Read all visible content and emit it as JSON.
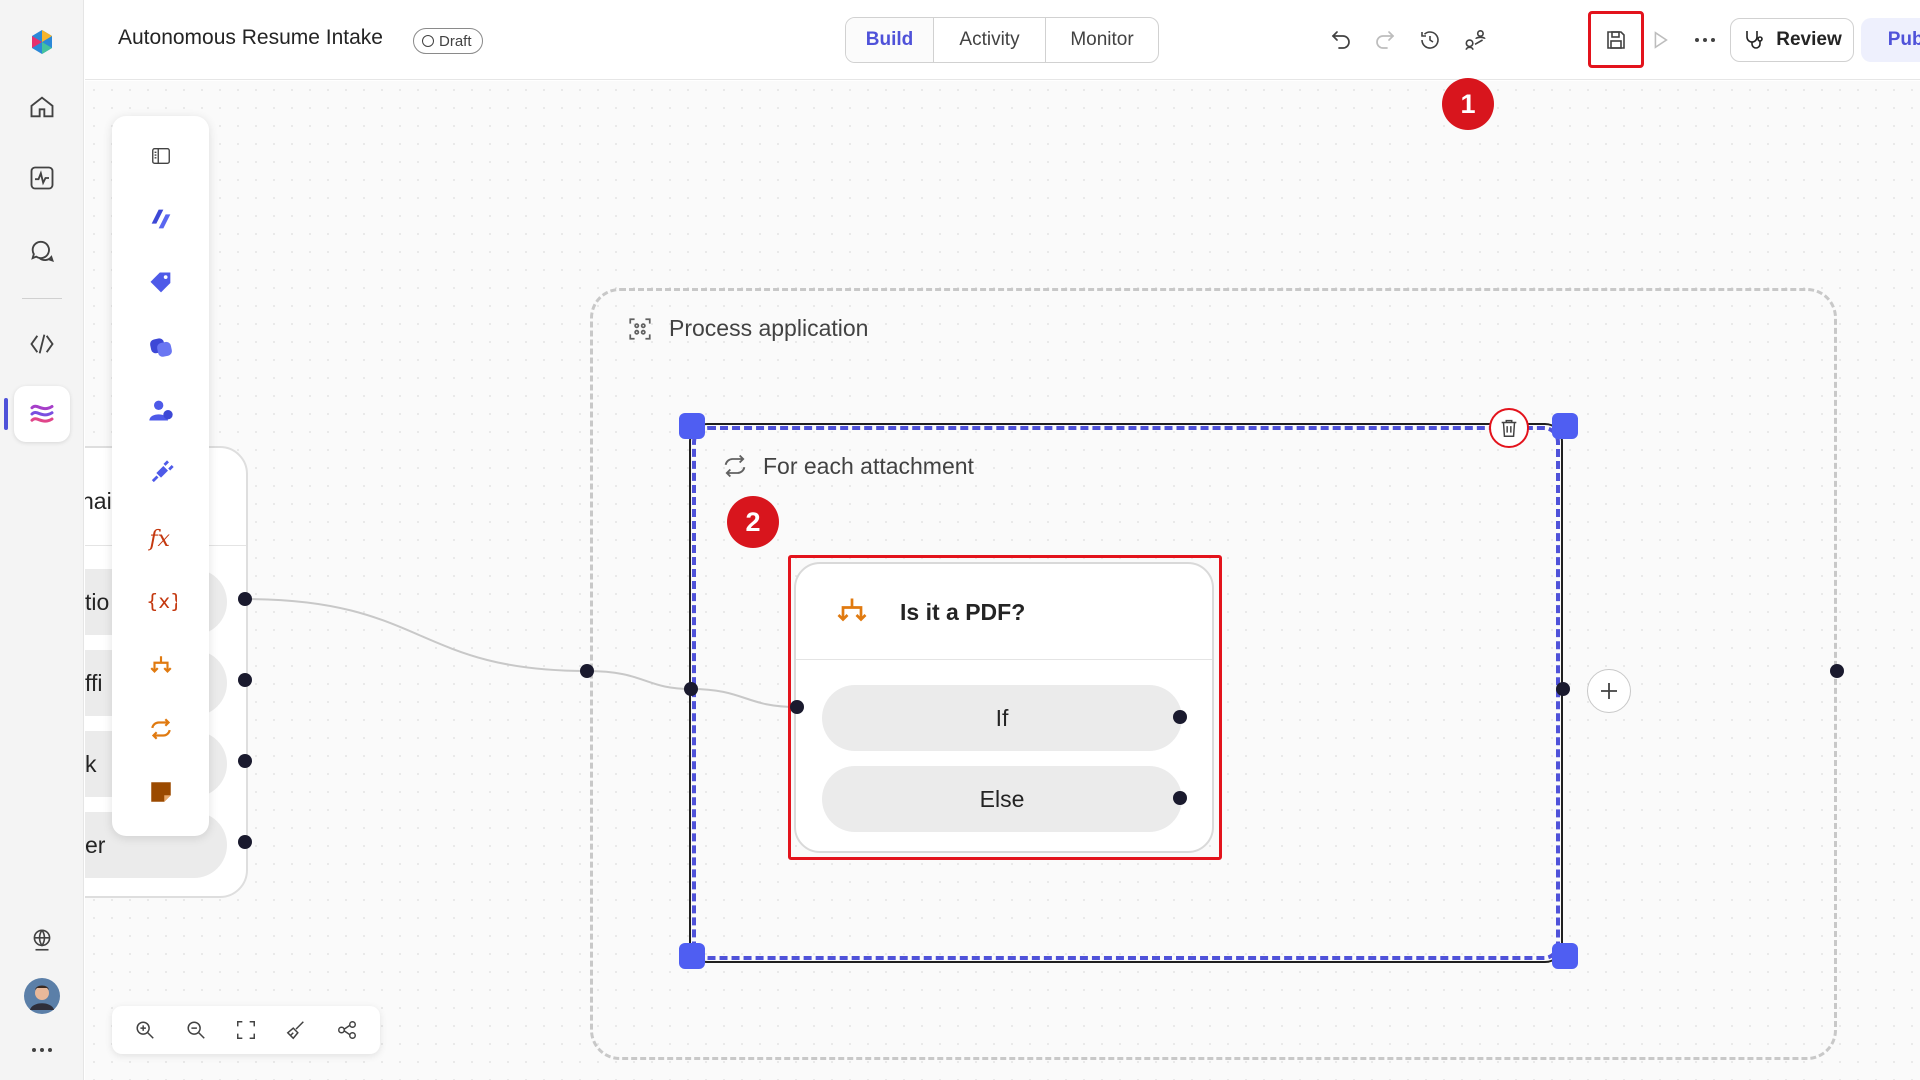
{
  "header": {
    "title": "Autonomous Resume Intake",
    "status_badge": "Draft",
    "tabs": [
      {
        "label": "Build",
        "selected": true
      },
      {
        "label": "Activity",
        "selected": false
      },
      {
        "label": "Monitor",
        "selected": false
      }
    ],
    "review_label": "Review",
    "publish_label": "Publish"
  },
  "annotations": {
    "step1": "1",
    "step2": "2"
  },
  "canvas": {
    "left_node": {
      "top_text": "nai",
      "rows": [
        "tio",
        "ffi",
        "k",
        "er"
      ]
    },
    "process_group": {
      "title": "Process application"
    },
    "loop": {
      "title": "For each attachment"
    },
    "condition": {
      "title": "Is it a PDF?",
      "branches": [
        "If",
        "Else"
      ]
    }
  },
  "colors": {
    "accent": "#4f52d9",
    "highlight_red": "#e3131c",
    "orange_icon": "#e07a10",
    "red_icon": "#c4380f",
    "handle_blue": "#4f5ef2"
  },
  "icons": {
    "rail": [
      "copilot-logo-icon",
      "home-icon",
      "activity-icon",
      "chat-icon",
      "code-brackets-icon",
      "agent-flows-icon",
      "globe-icon",
      "avatar",
      "more-icon"
    ],
    "toolbox": [
      "panel-toggle-icon",
      "ai-builder-icon",
      "tag-icon",
      "copilot-connector-icon",
      "human-review-icon",
      "connector-plug-icon",
      "function-fx-icon",
      "variable-icon",
      "condition-icon",
      "loop-icon",
      "sticky-note-icon"
    ],
    "zoombar": [
      "zoom-in-icon",
      "zoom-out-icon",
      "fit-view-icon",
      "clean-up-icon",
      "minimap-icon"
    ]
  }
}
